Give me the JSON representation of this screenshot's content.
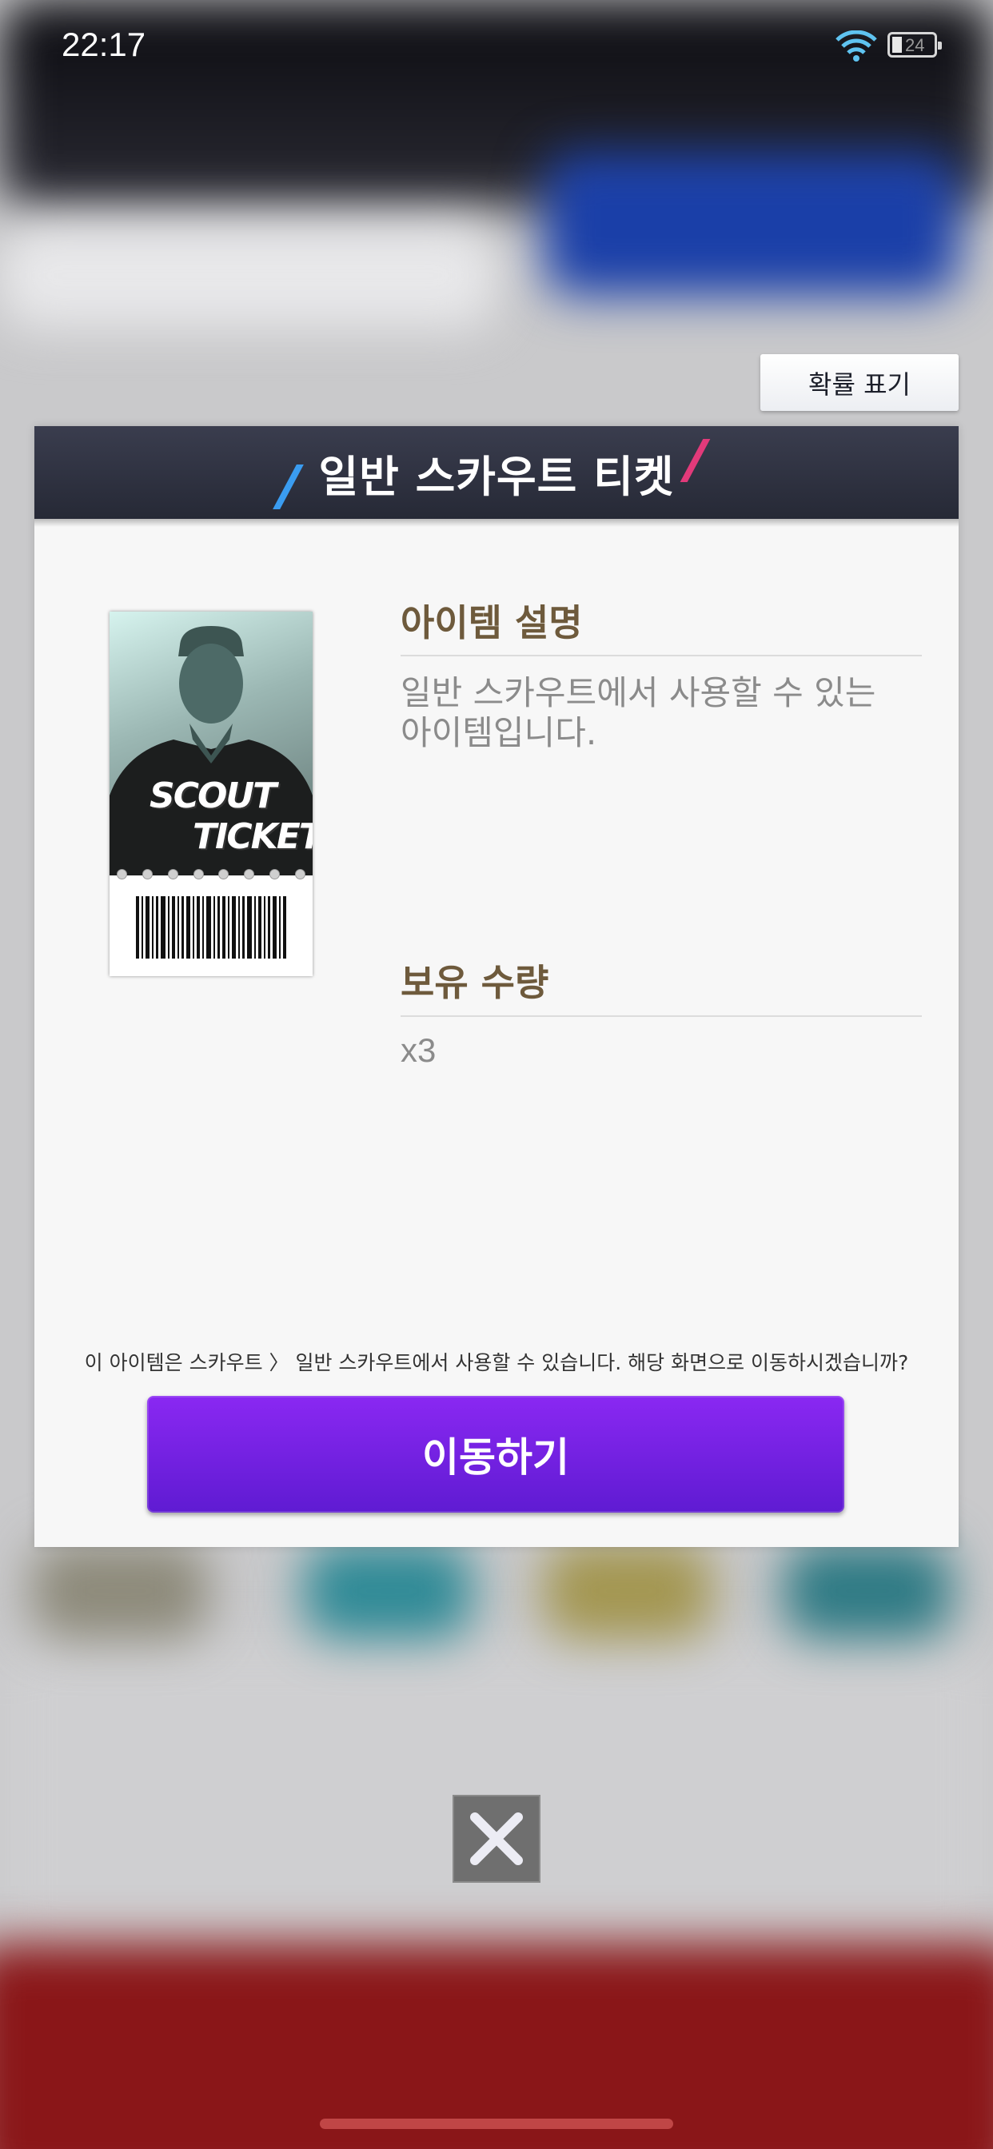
{
  "status_bar": {
    "time": "22:17",
    "battery_level": "24"
  },
  "probability_button": {
    "label": "확률 표기"
  },
  "dialog": {
    "title": "일반 스카우트 티켓",
    "item_image": {
      "line1": "SCOUT",
      "line2": "TICKET"
    },
    "description": {
      "heading": "아이템 설명",
      "text": "일반 스카우트에서 사용할 수 있는 아이템입니다."
    },
    "quantity": {
      "heading": "보유 수량",
      "value": "x3"
    },
    "notice": "이 아이템은 스카우트 〉 일반 스카우트에서 사용할 수 있습니다. 해당 화면으로 이동하시겠습니까?",
    "move_button": {
      "label": "이동하기"
    }
  },
  "colors": {
    "primary_button": "#7423e6",
    "header_bg": "#2e3140",
    "heading_text": "#6e5a3c"
  }
}
